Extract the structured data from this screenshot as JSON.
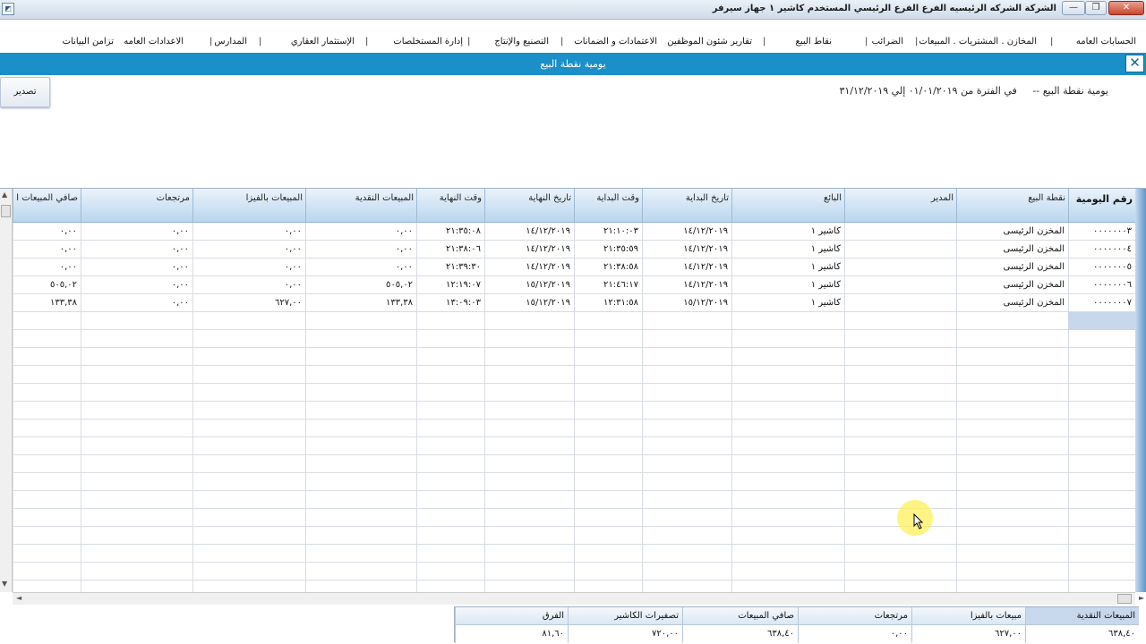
{
  "window": {
    "title": "الشركة الشركه الرئيسيه   الفرع الفرع الرئيسي   المستخدم كاشير ١   جهاز سيرفر",
    "app_icon_glyph": "◩",
    "min_glyph": "—",
    "max_glyph": "❐",
    "close_glyph": "✕"
  },
  "menu": {
    "items": [
      "الحسابات العامه",
      "المخازن . المشتريات . المبيعات",
      "الضرائب",
      "نقاط البيع",
      "تقارير شئون الموظفين",
      "الاعتمادات و الضمانات",
      "التصنيع والإنتاج",
      "إدارة المستخلصات",
      "الإستثمار العقاري",
      "المدارس",
      "الاعدادات العامه",
      "تزامن البيانات"
    ],
    "separator": "|"
  },
  "form": {
    "title": "يومية نقطة البيع",
    "close_glyph": "✕"
  },
  "toolbar": {
    "export_label": "تصدير"
  },
  "report": {
    "title": "يومية نقطة البيع --",
    "period": "في الفترة من ٠١/٠١/٢٠١٩ إلي ٣١/١٢/٢٠١٩"
  },
  "grid": {
    "columns": [
      "رقم اليومية",
      "نقطة البيع",
      "المدير",
      "البائع",
      "تاريخ البداية",
      "وقت البداية",
      "تاريخ النهاية",
      "وقت النهاية",
      "المبيعات النقدية",
      "المبيعات بالفيزا",
      "مرتجعات",
      "صافي المبيعات ا"
    ],
    "rows": [
      [
        "٠٠٠٠٠٠٠٣",
        "المخزن الرئيسى",
        "",
        "كاشير ١",
        "١٤/١٢/٢٠١٩",
        "٢١:١٠:٠٣",
        "١٤/١٢/٢٠١٩",
        "٢١:٣٥:٠٨",
        "٠,٠٠",
        "٠,٠٠",
        "٠,٠٠",
        "٠,٠٠"
      ],
      [
        "٠٠٠٠٠٠٠٤",
        "المخزن الرئيسى",
        "",
        "كاشير ١",
        "١٤/١٢/٢٠١٩",
        "٢١:٣٥:٥٩",
        "١٤/١٢/٢٠١٩",
        "٢١:٣٨:٠٦",
        "٠,٠٠",
        "٠,٠٠",
        "٠,٠٠",
        "٠,٠٠"
      ],
      [
        "٠٠٠٠٠٠٠٥",
        "المخزن الرئيسى",
        "",
        "كاشير ١",
        "١٤/١٢/٢٠١٩",
        "٢١:٣٨:٥٨",
        "١٤/١٢/٢٠١٩",
        "٢١:٣٩:٣٠",
        "٠,٠٠",
        "٠,٠٠",
        "٠,٠٠",
        "٠,٠٠"
      ],
      [
        "٠٠٠٠٠٠٠٦",
        "المخزن الرئيسى",
        "",
        "كاشير ١",
        "١٤/١٢/٢٠١٩",
        "٢١:٤٦:١٧",
        "١٥/١٢/٢٠١٩",
        "١٢:١٩:٠٧",
        "٥٠٥,٠٢",
        "٠,٠٠",
        "٠,٠٠",
        "٥٠٥,٠٢"
      ],
      [
        "٠٠٠٠٠٠٠٧",
        "المخزن الرئيسى",
        "",
        "كاشير ١",
        "١٥/١٢/٢٠١٩",
        "١٢:٣١:٥٨",
        "١٥/١٢/٢٠١٩",
        "١٣:٠٩:٠٣",
        "١٣٣,٣٨",
        "٦٢٧,٠٠",
        "٠,٠٠",
        "١٣٣,٣٨"
      ]
    ]
  },
  "totals": {
    "labels": [
      "المبيعات النقدية",
      "مبيعات بالفيزا",
      "مرتجعات",
      "صافي المبيعات",
      "تصفيرات الكاشير",
      "الفرق"
    ],
    "values": [
      "٦٣٨,٤٠",
      "٦٢٧,٠٠",
      "٠,٠٠",
      "٦٣٨,٤٠",
      "٧٢٠,٠٠",
      "٨١,٦٠"
    ]
  },
  "scrollbar": {
    "up_glyph": "▲",
    "down_glyph": "▼",
    "left_glyph": "◄",
    "right_glyph": "►"
  },
  "colors": {
    "form_header": "#1a8fc8",
    "grid_header": "#b9d6ef",
    "selection": "#c7d7ec",
    "cursor_highlight": "#fff05a"
  }
}
